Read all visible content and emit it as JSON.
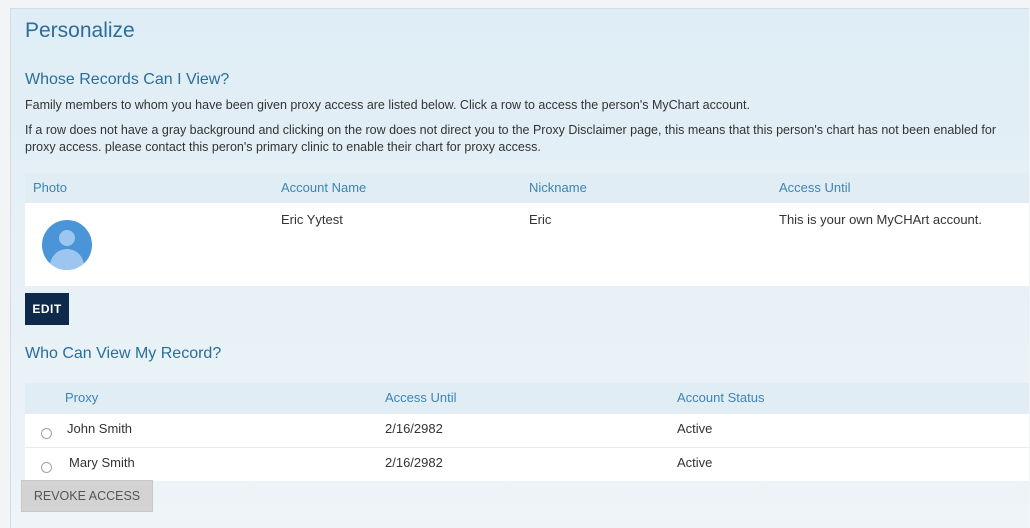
{
  "page": {
    "title": "Personalize"
  },
  "records_section": {
    "title": "Whose Records Can I View?",
    "description_1": "Family members to whom you have been given proxy access are listed below. Click a row to access the person's MyChart account.",
    "description_2": "If a row does not have a gray background and clicking on the row does not direct you to the Proxy Disclaimer page, this means that this person's chart has not been enabled for proxy access. please contact this peron's primary clinic to enable their chart for proxy access.",
    "columns": [
      "Photo",
      "Account Name",
      "Nickname",
      "Access Until"
    ],
    "rows": [
      {
        "photo_icon": "default-avatar-icon",
        "account_name": "Eric Yytest",
        "nickname": "Eric",
        "access_until": "This is your own MyCHArt account."
      }
    ],
    "edit_label": "EDIT"
  },
  "proxy_section": {
    "title": "Who Can View My Record?",
    "columns": [
      "Proxy",
      "Access Until",
      "Account Status"
    ],
    "rows": [
      {
        "proxy": "John Smith",
        "access_until": "2/16/2982",
        "status": "Active"
      },
      {
        "proxy": "Mary Smith",
        "access_until": "2/16/2982",
        "status": "Active"
      }
    ],
    "revoke_label": "REVOKE ACCESS"
  },
  "colors": {
    "heading": "#2a6e9b",
    "column_header": "#3e84b2",
    "edit_button": "#0d2a4a",
    "avatar": "#4a94d8"
  }
}
